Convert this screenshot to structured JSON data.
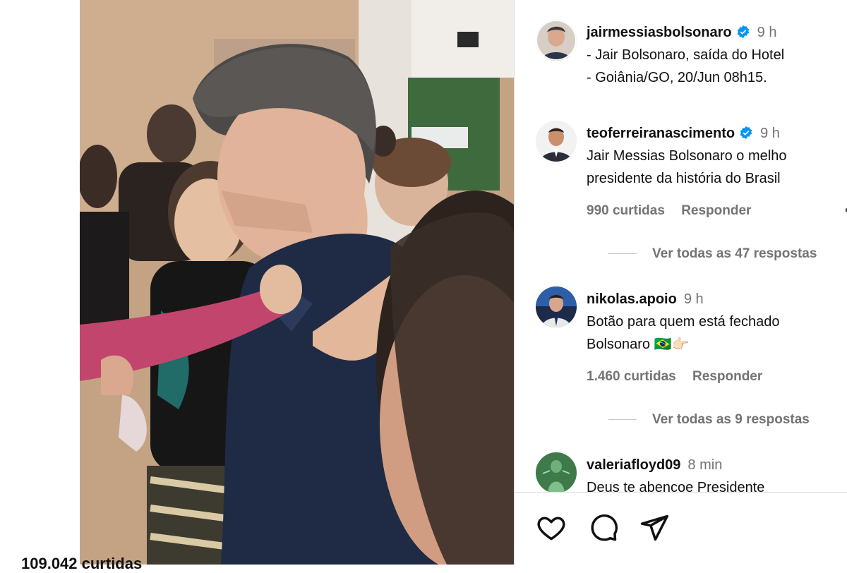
{
  "post": {
    "author": "jairmessiasbolsonaro",
    "time": "9 h",
    "caption_line1": "- Jair Bolsonaro, saída do Hotel",
    "caption_line2": "- Goiânia/GO, 20/Jun 08h15."
  },
  "comments": [
    {
      "username": "teoferreiranascimento",
      "verified": true,
      "time": "9 h",
      "line1": "Jair Messias Bolsonaro o melho",
      "line2": "presidente da história do Brasil",
      "likes": "990 curtidas",
      "reply_label": "Responder",
      "more_label": "•••",
      "view_replies": "Ver todas as 47 respostas"
    },
    {
      "username": "nikolas.apoio",
      "verified": false,
      "time": "9 h",
      "line1": "Botão para quem está fechado",
      "line2": "Bolsonaro 🇧🇷👉🏻",
      "likes": "1.460 curtidas",
      "reply_label": "Responder",
      "view_replies": "Ver todas as 9 respostas"
    },
    {
      "username": "valeriafloyd09",
      "verified": false,
      "time": "8 min",
      "line1": "Deus te abençoe Presidente"
    }
  ],
  "actions": {
    "like_icon": "heart-icon",
    "comment_icon": "comment-icon",
    "share_icon": "send-icon",
    "likes_total": "109.042 curtidas"
  },
  "colors": {
    "verified": "#0095f6",
    "muted": "#737373"
  }
}
